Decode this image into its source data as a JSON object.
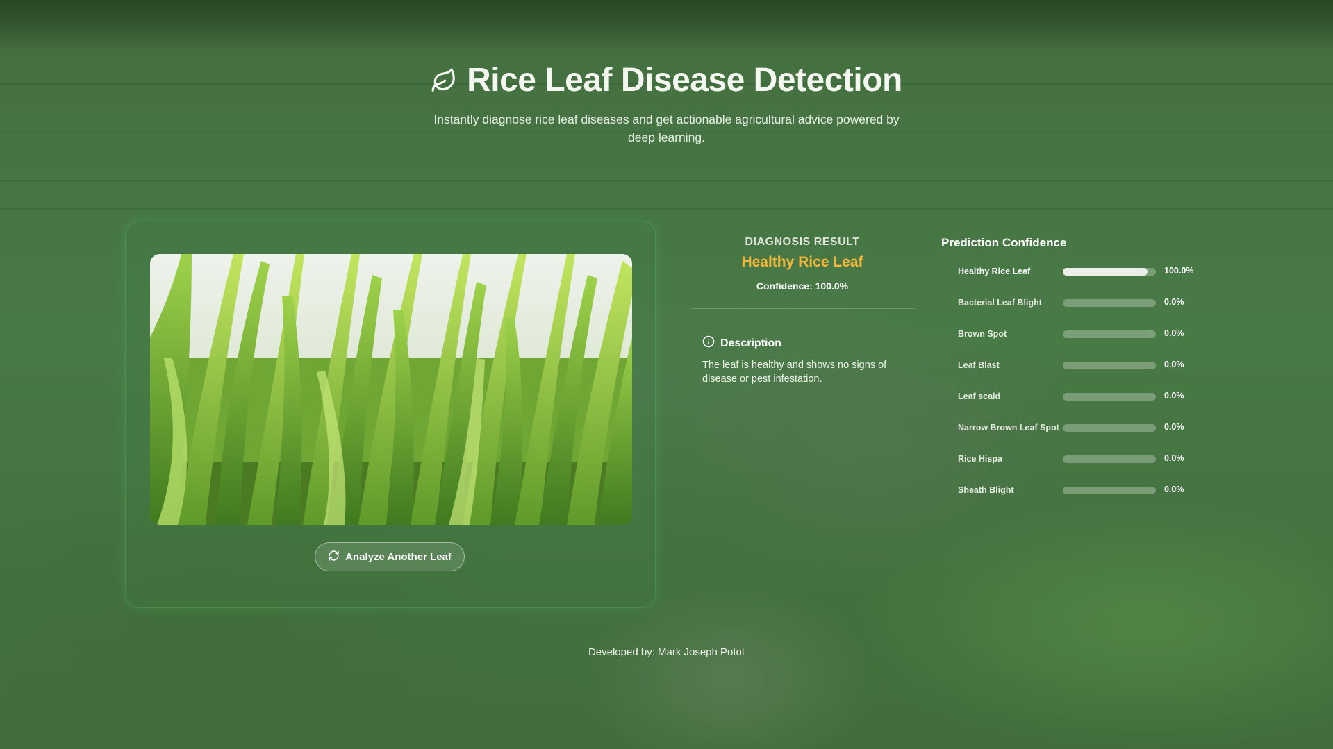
{
  "header": {
    "title": "Rice Leaf Disease Detection",
    "subtitle": "Instantly diagnose rice leaf diseases and get actionable agricultural advice powered by deep learning.",
    "icon": "leaf-icon"
  },
  "upload": {
    "image_alt": "Uploaded rice leaf photo",
    "analyze_button": "Analyze Another Leaf",
    "analyze_icon": "refresh-icon"
  },
  "result": {
    "label": "DIAGNOSIS RESULT",
    "diagnosis": "Healthy Rice Leaf",
    "confidence_text": "Confidence: 100.0%",
    "description_heading": "Description",
    "description_icon": "info-icon",
    "description": "The leaf is healthy and shows no signs of disease or pest infestation."
  },
  "confidence": {
    "title": "Prediction Confidence",
    "items": [
      {
        "label": "Healthy Rice Leaf",
        "value": 1.0,
        "pct": "100.0%"
      },
      {
        "label": "Bacterial Leaf Blight",
        "value": 0.0,
        "pct": "0.0%"
      },
      {
        "label": "Brown Spot",
        "value": 0.0,
        "pct": "0.0%"
      },
      {
        "label": "Leaf Blast",
        "value": 0.0,
        "pct": "0.0%"
      },
      {
        "label": "Leaf scald",
        "value": 0.0,
        "pct": "0.0%"
      },
      {
        "label": "Narrow Brown Leaf Spot",
        "value": 0.0,
        "pct": "0.0%"
      },
      {
        "label": "Rice Hispa",
        "value": 0.0,
        "pct": "0.0%"
      },
      {
        "label": "Sheath Blight",
        "value": 0.0,
        "pct": "0.0%"
      }
    ]
  },
  "footer": {
    "credit": "Developed by: Mark Joseph Potot"
  },
  "colors": {
    "accent": "#f4b73a",
    "bar_fill": "#eceeea",
    "card_border": "#50be6e"
  }
}
